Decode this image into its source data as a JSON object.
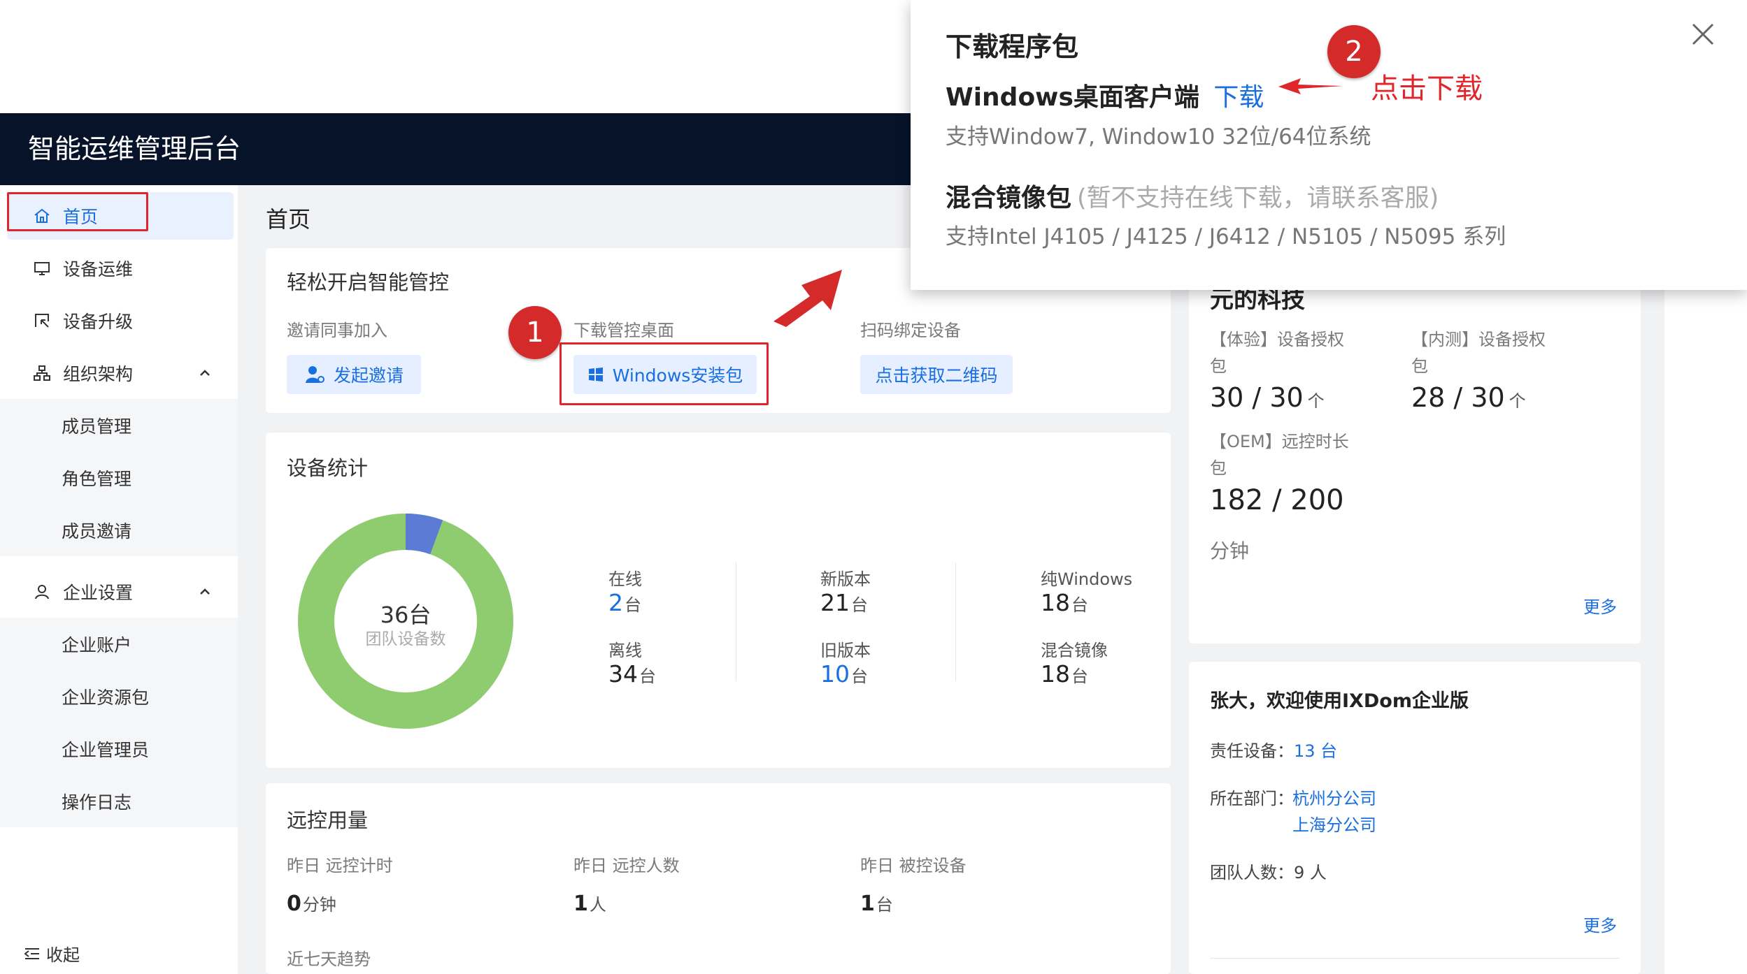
{
  "app": {
    "title": "智能运维管理后台"
  },
  "sidebar": {
    "items": [
      {
        "label": "首页"
      },
      {
        "label": "设备运维"
      },
      {
        "label": "设备升级"
      },
      {
        "label": "组织架构"
      },
      {
        "label": "企业设置"
      }
    ],
    "org_sub": [
      "成员管理",
      "角色管理",
      "成员邀请"
    ],
    "ent_sub": [
      "企业账户",
      "企业资源包",
      "企业管理员",
      "操作日志"
    ],
    "collapse": "收起"
  },
  "page": {
    "title": "首页"
  },
  "quickstart": {
    "title": "轻松开启智能管控",
    "invite_label": "邀请同事加入",
    "invite_btn": "发起邀请",
    "download_label": "下载管控桌面",
    "download_btn": "Windows安装包",
    "scan_label": "扫码绑定设备",
    "scan_btn": "点击获取二维码"
  },
  "devices": {
    "title": "设备统计",
    "total_value": "36台",
    "total_label": "团队设备数",
    "online_share": 0.056,
    "stats": [
      {
        "label": "在线",
        "num": "2",
        "unit": "台",
        "blue": true
      },
      {
        "label": "离线",
        "num": "34",
        "unit": "台",
        "blue": false
      },
      {
        "label": "新版本",
        "num": "21",
        "unit": "台",
        "blue": false
      },
      {
        "label": "旧版本",
        "num": "10",
        "unit": "台",
        "blue": true
      },
      {
        "label": "纯Windows",
        "num": "18",
        "unit": "台",
        "blue": false
      },
      {
        "label": "混合镜像",
        "num": "18",
        "unit": "台",
        "blue": false
      }
    ],
    "colors": {
      "online": "#5b7bd5",
      "offline": "#8fcb6f"
    }
  },
  "remote": {
    "title": "远控用量",
    "items": [
      {
        "label": "昨日 远控计时",
        "num": "0",
        "unit": "分钟"
      },
      {
        "label": "昨日 远控人数",
        "num": "1",
        "unit": "人"
      },
      {
        "label": "昨日 被控设备",
        "num": "1",
        "unit": "台"
      }
    ],
    "trend_label": "近七天趋势"
  },
  "resources": {
    "partial_title": "元的科技",
    "items": [
      {
        "label_l1": "【体验】设备授权",
        "label_l2": "包",
        "value": "30 / 30",
        "unit": "个"
      },
      {
        "label_l1": "【内测】设备授权",
        "label_l2": "包",
        "value": "28 / 30",
        "unit": "个"
      },
      {
        "label_l1": "【OEM】远控时长",
        "label_l2": "包",
        "value": "182 / 200",
        "unit": "分钟"
      }
    ],
    "more": "更多"
  },
  "welcome": {
    "title": "张大，欢迎使用IXDom企业版",
    "resp_label": "责任设备：",
    "resp_value": "13 台",
    "dept_label": "所在部门：",
    "depts": [
      "杭州分公司",
      "上海分公司"
    ],
    "team_label": "团队人数：",
    "team_value": "9 人",
    "more": "更多"
  },
  "modal": {
    "title": "下载程序包",
    "win_title": "Windows桌面客户端",
    "win_link": "下载",
    "win_desc": "支持Window7, Window10 32位/64位系统",
    "mix_title": "混合镜像包",
    "mix_note": "(暂不支持在线下载，请联系客服)",
    "mix_desc": "支持Intel J4105 / J4125 / J6412 / N5105 / N5095 系列"
  },
  "annotations": {
    "step1": "1",
    "step2": "2",
    "click_text": "点击下载"
  }
}
